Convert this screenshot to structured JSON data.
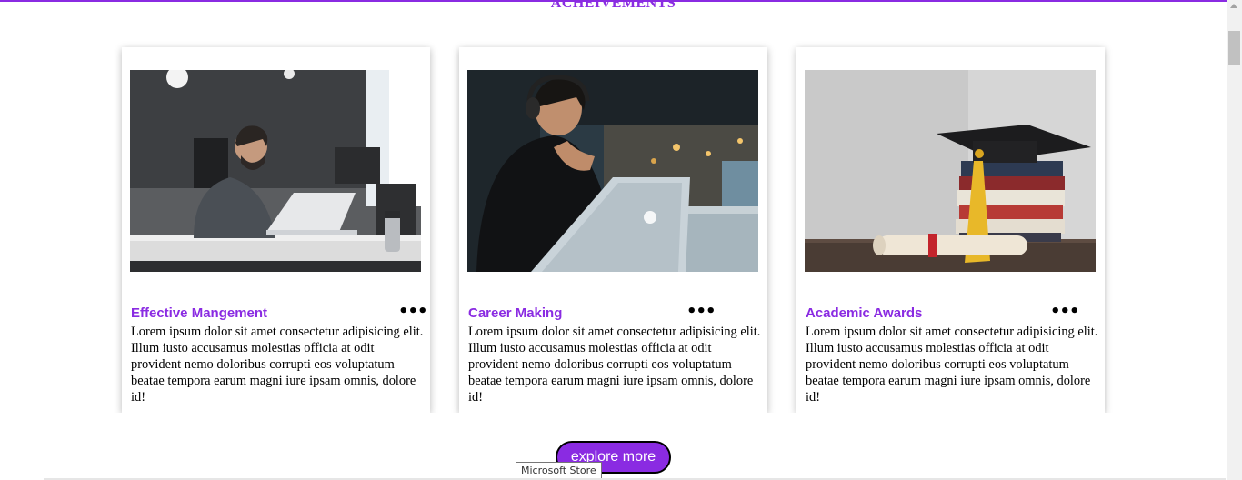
{
  "section": {
    "title": "ACHEIVEMENTS"
  },
  "cards": [
    {
      "title": "Effective Mangement",
      "text": "Lorem ipsum dolor sit amet consectetur adipisicing elit. Illum iusto accusamus molestias officia at odit provident nemo doloribus corrupti eos voluptatum beatae tempora earum magni iure ipsam omnis, dolore id!",
      "menu": "•••",
      "image": "man-working-laptop-office-photo"
    },
    {
      "title": "Career Making",
      "text": "Lorem ipsum dolor sit amet consectetur adipisicing elit. Illum iusto accusamus molestias officia at odit provident nemo doloribus corrupti eos voluptatum beatae tempora earum magni iure ipsam omnis, dolore id!",
      "menu": "•••",
      "image": "man-headphones-laptop-photo"
    },
    {
      "title": "Academic Awards",
      "text": "Lorem ipsum dolor sit amet consectetur adipisicing elit. Illum iusto accusamus molestias officia at odit provident nemo doloribus corrupti eos voluptatum beatae tempora earum magni iure ipsam omnis, dolore id!",
      "menu": "•••",
      "image": "graduation-cap-books-diploma-photo"
    }
  ],
  "explore_button": {
    "label": "explore more"
  },
  "tooltip": {
    "text": "Microsoft Store"
  },
  "colors": {
    "accent": "#8a2be2"
  }
}
